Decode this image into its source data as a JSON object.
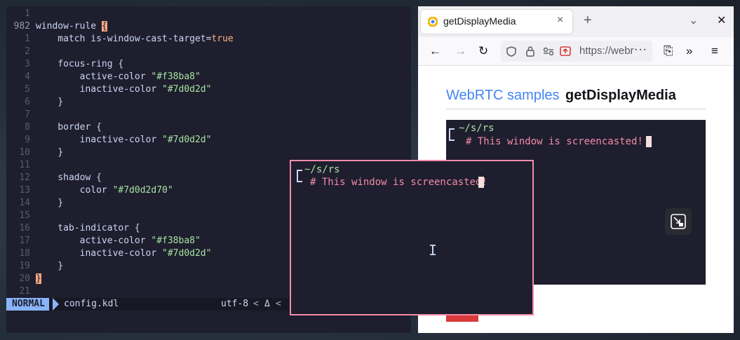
{
  "editor": {
    "lines": [
      {
        "num": "1",
        "parts": []
      },
      {
        "num": "982",
        "current": true,
        "parts": [
          {
            "t": "window-rule ",
            "c": "kw"
          },
          {
            "t": "{",
            "c": "brace-hl"
          }
        ]
      },
      {
        "num": "1",
        "parts": [
          {
            "t": "    match is-window-cast-target=",
            "c": "kw"
          },
          {
            "t": "true",
            "c": "bool"
          }
        ]
      },
      {
        "num": "2",
        "parts": []
      },
      {
        "num": "3",
        "parts": [
          {
            "t": "    focus-ring {",
            "c": "kw"
          }
        ]
      },
      {
        "num": "4",
        "parts": [
          {
            "t": "        active-color ",
            "c": "kw"
          },
          {
            "t": "\"#f38ba8\"",
            "c": "str"
          }
        ]
      },
      {
        "num": "5",
        "parts": [
          {
            "t": "        inactive-color ",
            "c": "kw"
          },
          {
            "t": "\"#7d0d2d\"",
            "c": "str"
          }
        ]
      },
      {
        "num": "6",
        "parts": [
          {
            "t": "    }",
            "c": "kw"
          }
        ]
      },
      {
        "num": "7",
        "parts": []
      },
      {
        "num": "8",
        "parts": [
          {
            "t": "    border {",
            "c": "kw"
          }
        ]
      },
      {
        "num": "9",
        "parts": [
          {
            "t": "        inactive-color ",
            "c": "kw"
          },
          {
            "t": "\"#7d0d2d\"",
            "c": "str"
          }
        ]
      },
      {
        "num": "10",
        "parts": [
          {
            "t": "    }",
            "c": "kw"
          }
        ]
      },
      {
        "num": "11",
        "parts": []
      },
      {
        "num": "12",
        "parts": [
          {
            "t": "    shadow {",
            "c": "kw"
          }
        ]
      },
      {
        "num": "13",
        "parts": [
          {
            "t": "        color ",
            "c": "kw"
          },
          {
            "t": "\"#7d0d2d70\"",
            "c": "str"
          }
        ]
      },
      {
        "num": "14",
        "parts": [
          {
            "t": "    }",
            "c": "kw"
          }
        ]
      },
      {
        "num": "15",
        "parts": []
      },
      {
        "num": "16",
        "parts": [
          {
            "t": "    tab-indicator {",
            "c": "kw"
          }
        ]
      },
      {
        "num": "17",
        "parts": [
          {
            "t": "        active-color ",
            "c": "kw"
          },
          {
            "t": "\"#f38ba8\"",
            "c": "str"
          }
        ]
      },
      {
        "num": "18",
        "parts": [
          {
            "t": "        inactive-color ",
            "c": "kw"
          },
          {
            "t": "\"#7d0d2d\"",
            "c": "str"
          }
        ]
      },
      {
        "num": "19",
        "parts": [
          {
            "t": "    }",
            "c": "kw"
          }
        ]
      },
      {
        "num": "20",
        "parts": [
          {
            "t": "}",
            "c": "brace-hl"
          }
        ]
      },
      {
        "num": "21",
        "parts": []
      }
    ],
    "status": {
      "mode": "NORMAL",
      "file": "config.kdl",
      "encoding": "utf-8",
      "sep": "<",
      "line_ending_icon": "Δ"
    }
  },
  "browser": {
    "tab_title": "getDisplayMedia",
    "tab_close": "×",
    "new_tab": "+",
    "tab_list_icon": "⌄",
    "window_close": "✕",
    "url": "https://webrtc.github.io",
    "url_more": "···",
    "breadcrumb": "WebRTC samples",
    "heading": "getDisplayMedia",
    "nav": {
      "back": "←",
      "forward": "→",
      "reload": "↻",
      "extensions": "⎘",
      "overflow": "»",
      "menu": "≡"
    }
  },
  "terminal": {
    "path": "~/s/rs",
    "comment": "# This window is screencasted!"
  },
  "colors": {
    "focus_ring": "#f38ba8",
    "string": "#a6e3a1",
    "accent_blue": "#4285f4"
  }
}
